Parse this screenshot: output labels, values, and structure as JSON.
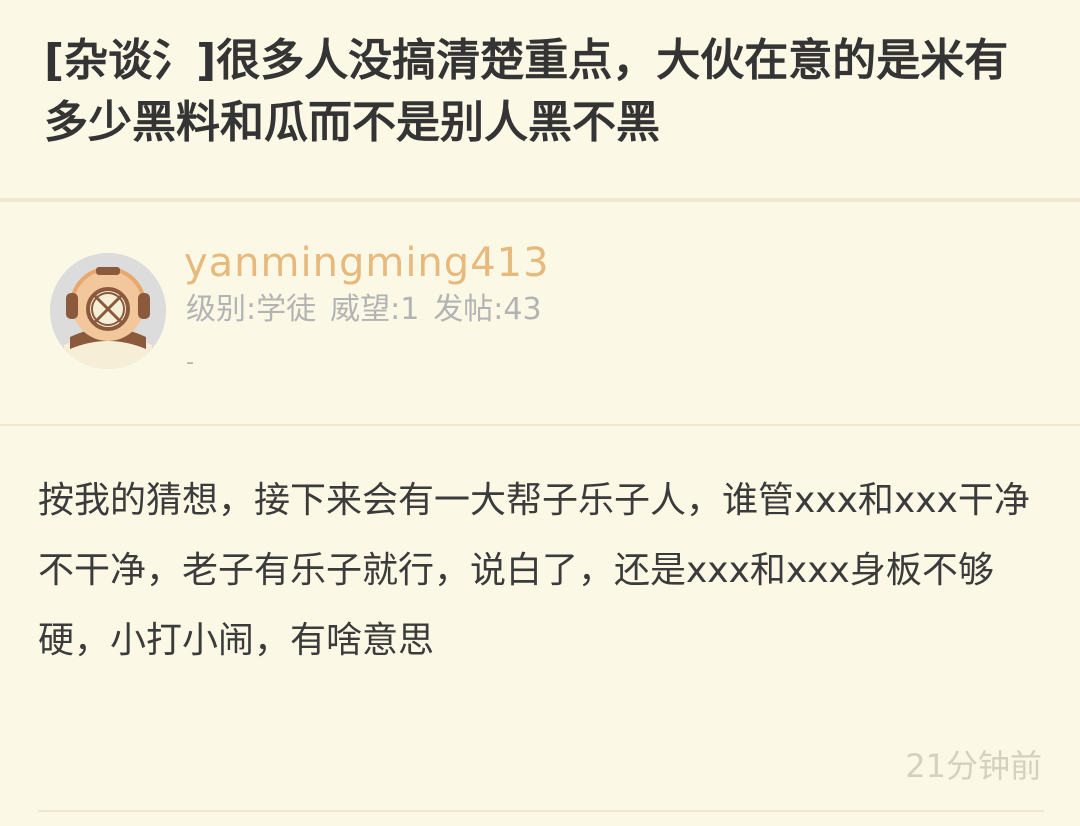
{
  "post": {
    "title": "[杂谈氵]很多人没搞清楚重点，大伙在意的是米有多少黑料和瓜而不是别人黑不黑",
    "body": "按我的猜想，接下来会有一大帮子乐子人，谁管xxx和xxx干净不干净，老子有乐子就行，说白了，还是xxx和xxx身板不够硬，小打小闹，有啥意思",
    "time": "21分钟前"
  },
  "author": {
    "username": "yanmingming413",
    "level": "级别:学徒",
    "prestige": "威望:1",
    "posts": "发帖:43",
    "signature": "-",
    "avatar_icon": "diving-helmet-icon"
  },
  "colors": {
    "background": "#fcf8e6",
    "title": "#343434",
    "username": "#e8b97c",
    "meta": "#b3b3b3",
    "divider": "#efe9d2"
  }
}
